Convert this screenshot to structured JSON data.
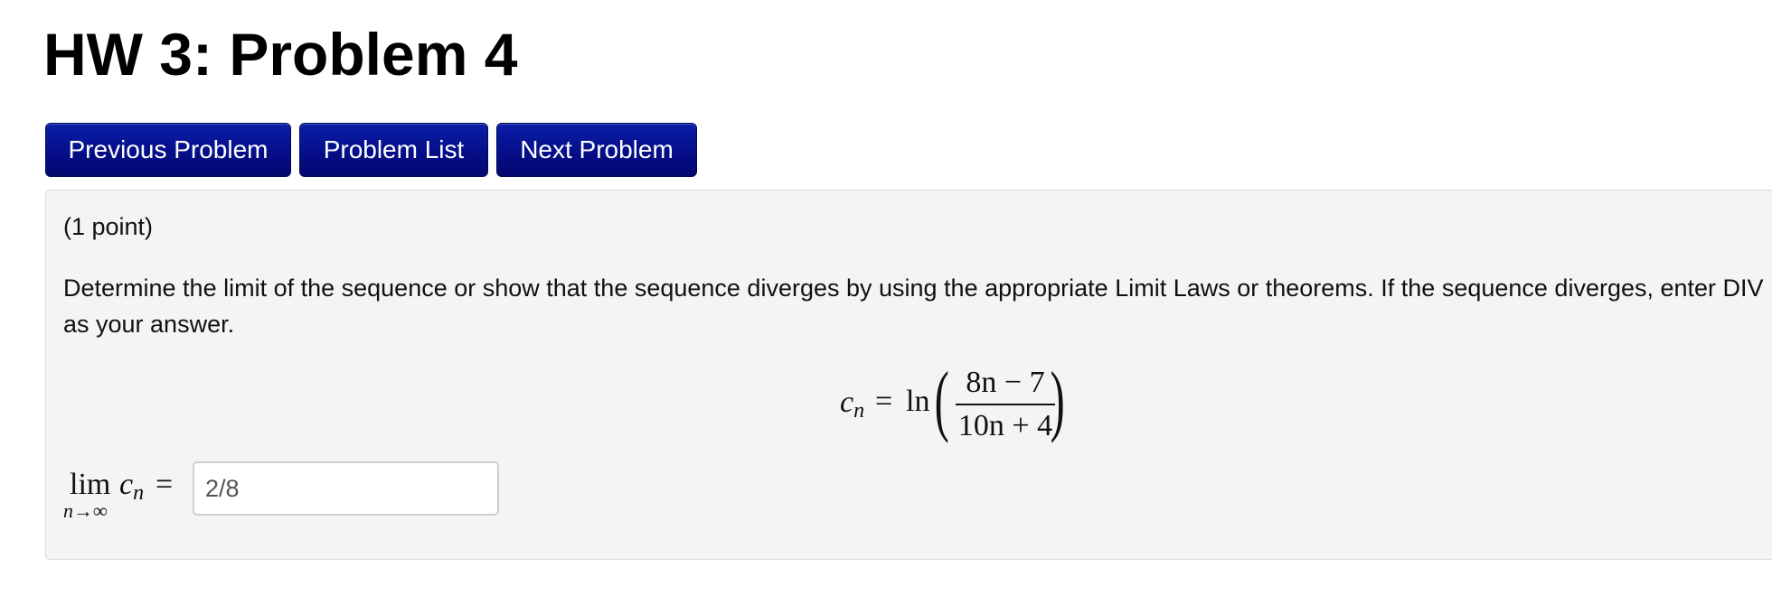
{
  "page": {
    "title": "HW 3: Problem 4"
  },
  "nav": {
    "previous_label": "Previous Problem",
    "list_label": "Problem List",
    "next_label": "Next Problem",
    "button_color": "#050d86"
  },
  "problem": {
    "points": "(1 point)",
    "statement": "Determine the limit of the sequence or show that the sequence diverges by using the appropriate Limit Laws or theorems. If the sequence diverges, enter DIV as your answer.",
    "equation": {
      "lhs_var": "c",
      "lhs_sub": "n",
      "equals": "=",
      "function": "ln",
      "numerator": "8n − 7",
      "denominator": "10n + 4"
    },
    "answer": {
      "limit_word": "lim",
      "limit_subscript": "n→∞",
      "limit_var": "c",
      "limit_var_sub": "n",
      "equals": "=",
      "value": "2/8"
    }
  },
  "colors": {
    "box_background": "#f4f4f4",
    "box_border": "#d9d9d9"
  }
}
